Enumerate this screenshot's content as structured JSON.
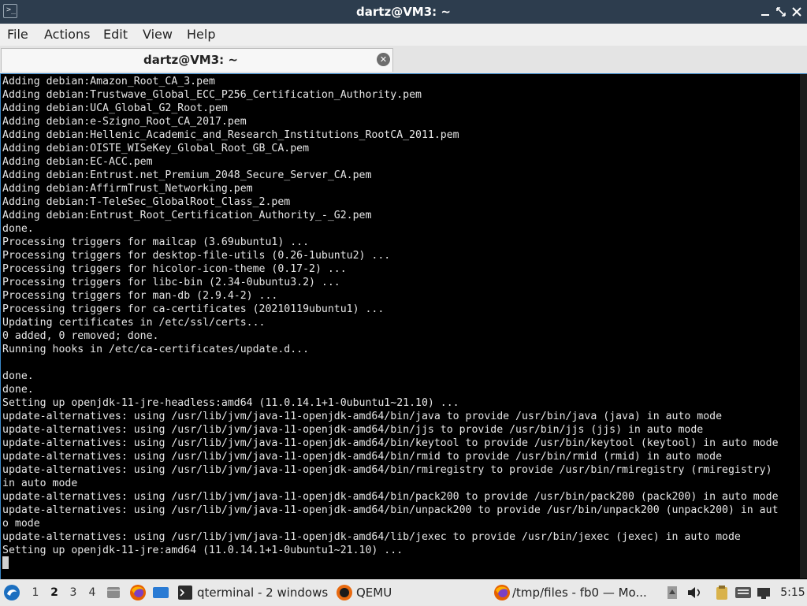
{
  "window": {
    "title": "dartz@VM3: ~",
    "app_icon_glyph": ">_"
  },
  "menu": [
    "File",
    "Actions",
    "Edit",
    "View",
    "Help"
  ],
  "tab": {
    "label": "dartz@VM3: ~"
  },
  "terminal": {
    "lines": [
      "Adding debian:Amazon_Root_CA_3.pem",
      "Adding debian:Trustwave_Global_ECC_P256_Certification_Authority.pem",
      "Adding debian:UCA_Global_G2_Root.pem",
      "Adding debian:e-Szigno_Root_CA_2017.pem",
      "Adding debian:Hellenic_Academic_and_Research_Institutions_RootCA_2011.pem",
      "Adding debian:OISTE_WISeKey_Global_Root_GB_CA.pem",
      "Adding debian:EC-ACC.pem",
      "Adding debian:Entrust.net_Premium_2048_Secure_Server_CA.pem",
      "Adding debian:AffirmTrust_Networking.pem",
      "Adding debian:T-TeleSec_GlobalRoot_Class_2.pem",
      "Adding debian:Entrust_Root_Certification_Authority_-_G2.pem",
      "done.",
      "Processing triggers for mailcap (3.69ubuntu1) ...",
      "Processing triggers for desktop-file-utils (0.26-1ubuntu2) ...",
      "Processing triggers for hicolor-icon-theme (0.17-2) ...",
      "Processing triggers for libc-bin (2.34-0ubuntu3.2) ...",
      "Processing triggers for man-db (2.9.4-2) ...",
      "Processing triggers for ca-certificates (20210119ubuntu1) ...",
      "Updating certificates in /etc/ssl/certs...",
      "0 added, 0 removed; done.",
      "Running hooks in /etc/ca-certificates/update.d...",
      "",
      "done.",
      "done.",
      "Setting up openjdk-11-jre-headless:amd64 (11.0.14.1+1-0ubuntu1~21.10) ...",
      "update-alternatives: using /usr/lib/jvm/java-11-openjdk-amd64/bin/java to provide /usr/bin/java (java) in auto mode",
      "update-alternatives: using /usr/lib/jvm/java-11-openjdk-amd64/bin/jjs to provide /usr/bin/jjs (jjs) in auto mode",
      "update-alternatives: using /usr/lib/jvm/java-11-openjdk-amd64/bin/keytool to provide /usr/bin/keytool (keytool) in auto mode",
      "update-alternatives: using /usr/lib/jvm/java-11-openjdk-amd64/bin/rmid to provide /usr/bin/rmid (rmid) in auto mode",
      "update-alternatives: using /usr/lib/jvm/java-11-openjdk-amd64/bin/rmiregistry to provide /usr/bin/rmiregistry (rmiregistry)",
      "in auto mode",
      "update-alternatives: using /usr/lib/jvm/java-11-openjdk-amd64/bin/pack200 to provide /usr/bin/pack200 (pack200) in auto mode",
      "update-alternatives: using /usr/lib/jvm/java-11-openjdk-amd64/bin/unpack200 to provide /usr/bin/unpack200 (unpack200) in aut",
      "o mode",
      "update-alternatives: using /usr/lib/jvm/java-11-openjdk-amd64/lib/jexec to provide /usr/bin/jexec (jexec) in auto mode",
      "Setting up openjdk-11-jre:amd64 (11.0.14.1+1-0ubuntu1~21.10) ..."
    ]
  },
  "taskbar": {
    "workspaces": [
      "1",
      "2",
      "3",
      "4"
    ],
    "active_workspace": "2",
    "tasks": [
      {
        "label": "qterminal - 2 windows",
        "icon": "terminal-icon"
      },
      {
        "label": "QEMU",
        "icon": "qemu-icon"
      },
      {
        "label": "/tmp/files - fb0 — Mo...",
        "icon": "firefox-icon"
      }
    ],
    "clock": "5:15"
  },
  "colors": {
    "titlebar": "#2d3d4e",
    "terminal_bg": "#000000",
    "terminal_fg": "#e6e6e6",
    "accent": "#3a87c8"
  }
}
